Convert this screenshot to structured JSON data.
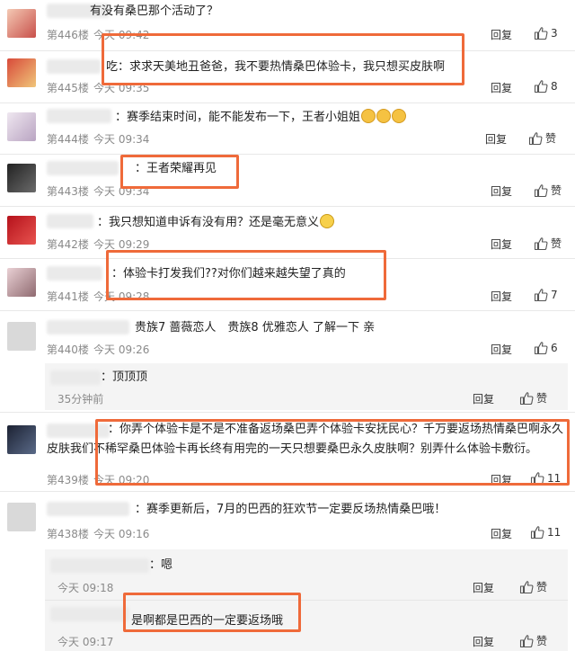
{
  "reply_label": "回复",
  "like_label": "赞",
  "comments": [
    {
      "floor": "第446楼",
      "time": "今天 09:42",
      "text": "有没有桑巴那个活动了？",
      "likes": "3"
    },
    {
      "floor": "第445楼",
      "time": "今天 09:35",
      "text": "吃：求求天美地丑爸爸，我不要热情桑巴体验卡，我只想买皮肤啊",
      "likes": "8"
    },
    {
      "floor": "第444楼",
      "time": "今天 09:34",
      "text": "：赛季结束时间，能不能发布一下，王者小姐姐",
      "likes": ""
    },
    {
      "floor": "第443楼",
      "time": "今天 09:34",
      "text": "：王者荣耀再见",
      "likes": ""
    },
    {
      "floor": "第442楼",
      "time": "今天 09:29",
      "text": "：我只想知道申诉有没有用？还是毫无意义",
      "likes": ""
    },
    {
      "floor": "第441楼",
      "time": "今天 09:28",
      "text": "：体验卡打发我们??对你们越来越失望了真的",
      "likes": "7"
    },
    {
      "floor": "第440楼",
      "time": "今天 09:26",
      "text": "贵族7 蔷薇恋人　贵族8 优雅恋人 了解一下 亲",
      "likes": "6"
    },
    {
      "floor": "第439楼",
      "time": "今天 09:20",
      "text": "：你弄个体验卡是不是不准备返场桑巴弄个体验卡安抚民心？千万要返场热情桑巴啊永久皮肤我们不稀罕桑巴体验卡再长终有用完的一天只想要桑巴永久皮肤啊？别弄什么体验卡敷衍。",
      "likes": "11"
    },
    {
      "floor": "第438楼",
      "time": "今天 09:16",
      "text": "：赛季更新后，7月的巴西的狂欢节一定要反场热情桑巴哦！",
      "likes": "11"
    }
  ],
  "replies": [
    {
      "text": "：顶顶顶",
      "time": "35分钟前"
    },
    {
      "text": "：嗯",
      "time": "今天 09:18"
    },
    {
      "text": "是啊都是巴西的一定要返场哦",
      "time": "今天 09:17"
    }
  ]
}
